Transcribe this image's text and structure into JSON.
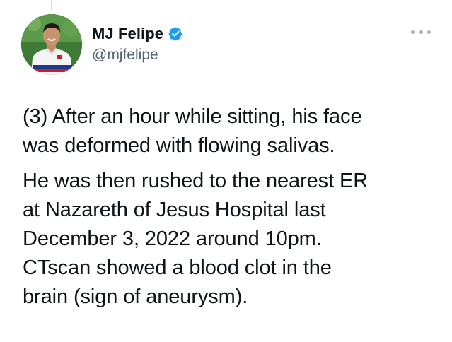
{
  "author": {
    "display_name": "MJ Felipe",
    "handle": "@mjfelipe",
    "verified": true,
    "avatar_icon": "profile-photo-avatar",
    "verified_icon": "verified-badge-icon"
  },
  "actions": {
    "more_icon": "more-horizontal-icon"
  },
  "tweet": {
    "paragraphs": [
      {
        "lines": [
          "(3) After an hour while sitting, his face",
          "was deformed with flowing salivas."
        ]
      },
      {
        "lines": [
          "He was then rushed to the nearest ER",
          "at Nazareth of Jesus Hospital last",
          "December 3, 2022 around 10pm.",
          "CTscan showed a blood clot in the",
          "brain (sign of aneurysm)."
        ]
      }
    ]
  },
  "colors": {
    "text_primary": "#0f1419",
    "text_secondary": "#536471",
    "verified_blue": "#1d9bf0",
    "thread_line": "#cfd9de"
  }
}
